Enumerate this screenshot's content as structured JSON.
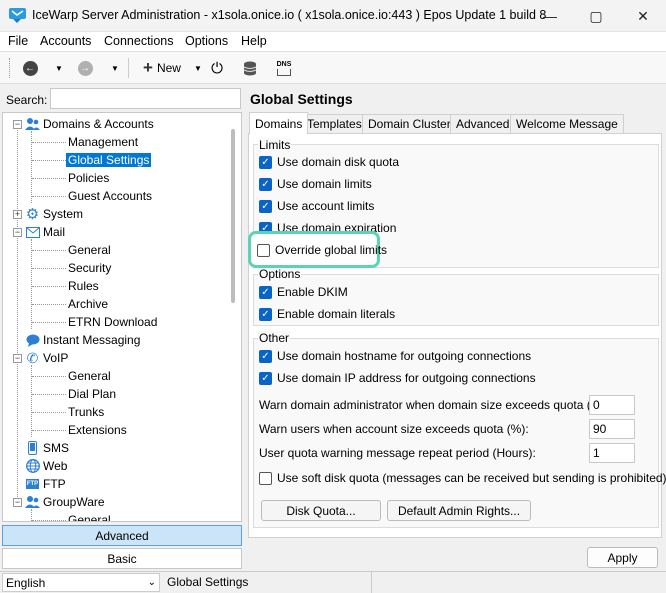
{
  "window": {
    "title": "IceWarp Server Administration - x1sola.onice.io ( x1sola.onice.io:443 ) Epos Update 1 build 8",
    "accent": "#0a64c8",
    "highlight_color": "#5bd3b5"
  },
  "menu": [
    "File",
    "Accounts",
    "Connections",
    "Options",
    "Help"
  ],
  "toolbar": {
    "new_label": "New",
    "dns_label": "DNS"
  },
  "search": {
    "label": "Search:",
    "value": ""
  },
  "tree": {
    "domains": "Domains & Accounts",
    "management": "Management",
    "global_settings": "Global Settings",
    "policies": "Policies",
    "guest_accounts": "Guest Accounts",
    "system": "System",
    "mail": "Mail",
    "mail_general": "General",
    "mail_security": "Security",
    "mail_rules": "Rules",
    "mail_archive": "Archive",
    "mail_etrn": "ETRN Download",
    "instant_messaging": "Instant Messaging",
    "voip": "VoIP",
    "voip_general": "General",
    "voip_dialplan": "Dial Plan",
    "voip_trunks": "Trunks",
    "voip_extensions": "Extensions",
    "sms": "SMS",
    "web": "Web",
    "ftp": "FTP",
    "groupware": "GroupWare",
    "gw_general": "General"
  },
  "panel_buttons": {
    "advanced": "Advanced",
    "basic": "Basic"
  },
  "main": {
    "title": "Global Settings",
    "tabs": [
      "Domains",
      "Templates",
      "Domain Clusters",
      "Advanced",
      "Welcome Message"
    ],
    "limits": {
      "label": "Limits",
      "disk_quota": "Use domain disk quota",
      "domain_limits": "Use domain limits",
      "account_limits": "Use account limits",
      "domain_expiration": "Use domain expiration",
      "override": "Override global limits"
    },
    "options": {
      "label": "Options",
      "dkim": "Enable DKIM",
      "literals": "Enable domain literals"
    },
    "other": {
      "label": "Other",
      "hostname": "Use domain hostname for outgoing connections",
      "ip": "Use domain IP address for outgoing connections",
      "warn_admin_label": "Warn domain administrator when domain size exceeds quota (%):",
      "warn_admin_value": "0",
      "warn_users_label": "Warn users when account size exceeds quota (%):",
      "warn_users_value": "90",
      "repeat_label": "User quota warning message repeat period (Hours):",
      "repeat_value": "1",
      "soft_quota": "Use soft disk quota (messages can be received but sending is prohibited)",
      "disk_quota_button": "Disk Quota...",
      "admin_rights_button": "Default Admin Rights..."
    },
    "apply": "Apply"
  },
  "status": {
    "language": "English",
    "location": "Global Settings"
  }
}
